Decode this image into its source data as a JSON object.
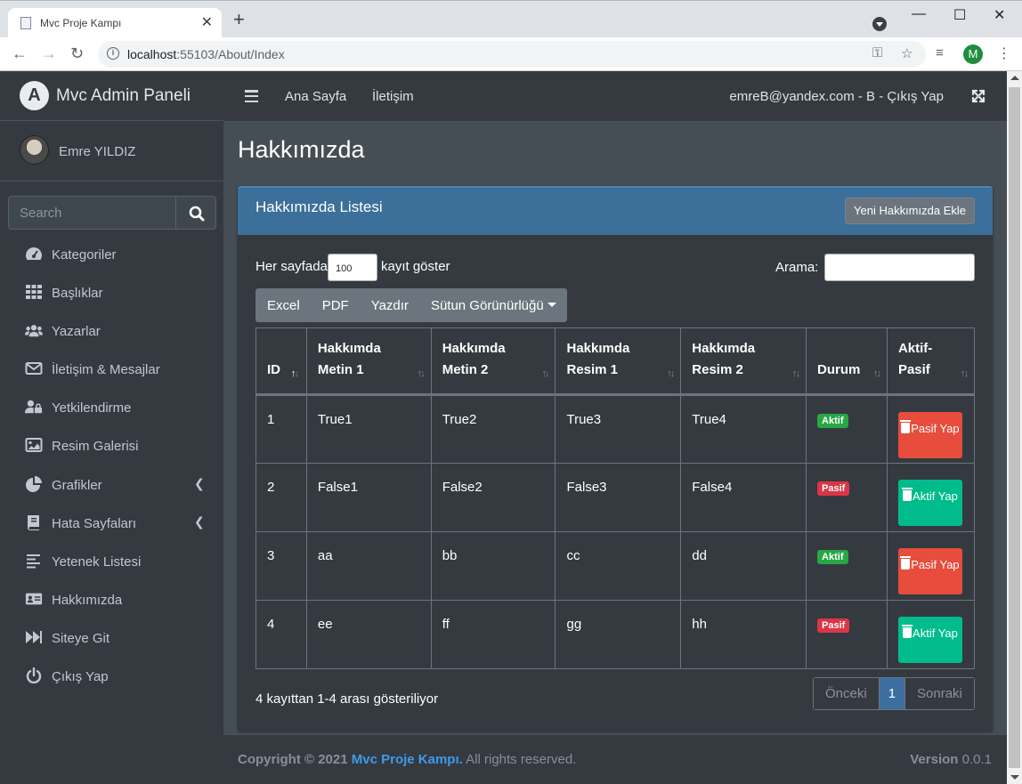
{
  "browser": {
    "tab_title": "Mvc Proje Kampı",
    "url_host": "localhost",
    "url_rest": ":55103/About/Index",
    "avatar_letter": "M"
  },
  "sidebar": {
    "brand": "Mvc Admin Paneli",
    "user_name": "Emre YILDIZ",
    "search_placeholder": "Search",
    "items": [
      {
        "label": "Kategoriler",
        "icon": "dashboard-gauge-icon"
      },
      {
        "label": "Başlıklar",
        "icon": "grid-icon"
      },
      {
        "label": "Yazarlar",
        "icon": "users-icon"
      },
      {
        "label": "İletişim & Mesajlar",
        "icon": "envelope-icon"
      },
      {
        "label": "Yetkilendirme",
        "icon": "user-lock-icon"
      },
      {
        "label": "Resim Galerisi",
        "icon": "image-icon"
      },
      {
        "label": "Grafikler",
        "icon": "pie-chart-icon"
      },
      {
        "label": "Hata Sayfaları",
        "icon": "book-icon"
      },
      {
        "label": "Yetenek Listesi",
        "icon": "align-left-icon"
      },
      {
        "label": "Hakkımızda",
        "icon": "id-card-icon"
      },
      {
        "label": "Siteye Git",
        "icon": "fast-forward-icon"
      },
      {
        "label": "Çıkış Yap",
        "icon": "power-icon"
      }
    ]
  },
  "topnav": {
    "home": "Ana Sayfa",
    "contact": "İletişim",
    "user": "emreB@yandex.com - B - Çıkış Yap"
  },
  "page": {
    "title": "Hakkımızda",
    "card_title": "Hakkımızda Listesi",
    "add_button": "Yeni Hakkımızda Ekle",
    "length_before": "Her sayfada",
    "length_value": "100",
    "length_after": "kayıt göster",
    "search_label": "Arama:",
    "buttons": [
      "Excel",
      "PDF",
      "Yazdır",
      "Sütun Görünürlüğü"
    ]
  },
  "table": {
    "columns": [
      "ID",
      "Hakkımda Metin 1",
      "Hakkımda Metin 2",
      "Hakkımda Resim 1",
      "Hakkımda Resim 2",
      "Durum",
      "Aktif-Pasif"
    ],
    "rows": [
      {
        "id": "1",
        "m1": "True1",
        "m2": "True2",
        "r1": "True3",
        "r2": "True4",
        "status": "Aktif",
        "action": "Pasif Yap"
      },
      {
        "id": "2",
        "m1": "False1",
        "m2": "False2",
        "r1": "False3",
        "r2": "False4",
        "status": "Pasif",
        "action": "Aktif Yap"
      },
      {
        "id": "3",
        "m1": "aa",
        "m2": "bb",
        "r1": "cc",
        "r2": "dd",
        "status": "Aktif",
        "action": "Pasif Yap"
      },
      {
        "id": "4",
        "m1": "ee",
        "m2": "ff",
        "r1": "gg",
        "r2": "hh",
        "status": "Pasif",
        "action": "Aktif Yap"
      }
    ],
    "info": "4 kayıttan 1-4 arası gösteriliyor",
    "pager": {
      "prev": "Önceki",
      "current": "1",
      "next": "Sonraki"
    }
  },
  "footer": {
    "copyright": "Copyright © 2021",
    "link": "Mvc Proje Kampı.",
    "rights": "All rights reserved.",
    "version_label": "Version",
    "version": "0.0.1"
  }
}
